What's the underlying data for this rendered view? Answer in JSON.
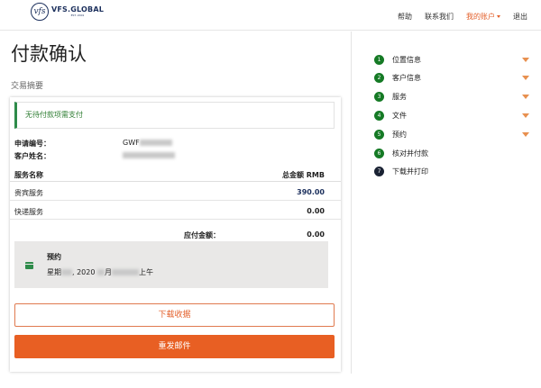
{
  "header": {
    "logo_mark": "vfs",
    "logo_name": "VFS.GLOBAL",
    "logo_sub": "EST. 2001",
    "nav": [
      {
        "label": "帮助"
      },
      {
        "label": "联系我们"
      },
      {
        "label": "我的账户"
      },
      {
        "label": "退出"
      }
    ]
  },
  "page": {
    "title": "付款确认",
    "section_label": "交易摘要"
  },
  "summary": {
    "notice": "无待付款项需支付",
    "application_no_label": "申请编号：",
    "application_no_prefix": "GWF",
    "customer_name_label": "客户姓名：",
    "table_header": {
      "service": "服务名称",
      "total": "总金额 RMB"
    },
    "rows": [
      {
        "service": "贵宾服务",
        "amount": "390.00"
      },
      {
        "service": "快递服务",
        "amount": "0.00"
      }
    ],
    "payable_label": "应付金额：",
    "payable_amount": "0.00",
    "appointment": {
      "title": "预约",
      "date_prefix": "星期",
      "date_year": "2020",
      "date_month": "月",
      "date_suffix": "上午"
    },
    "download_receipt": "下载收据",
    "resend_email": "重发邮件"
  },
  "steps": [
    {
      "num": "1",
      "label": "位置信息"
    },
    {
      "num": "2",
      "label": "客户信息"
    },
    {
      "num": "3",
      "label": "服务"
    },
    {
      "num": "4",
      "label": "文件"
    },
    {
      "num": "5",
      "label": "预约"
    },
    {
      "num": "6",
      "label": "核对并付款"
    },
    {
      "num": "7",
      "label": "下载并打印"
    }
  ],
  "colors": {
    "accent": "#e85f23",
    "brand": "#1b2f5c",
    "step_done": "#157a25",
    "step_current": "#1a2233",
    "notice_green": "#2e7d32"
  },
  "icons": {
    "appointment": "calendar-icon",
    "step_expand": "caret-down-icon",
    "account_menu": "caret-down-icon"
  }
}
